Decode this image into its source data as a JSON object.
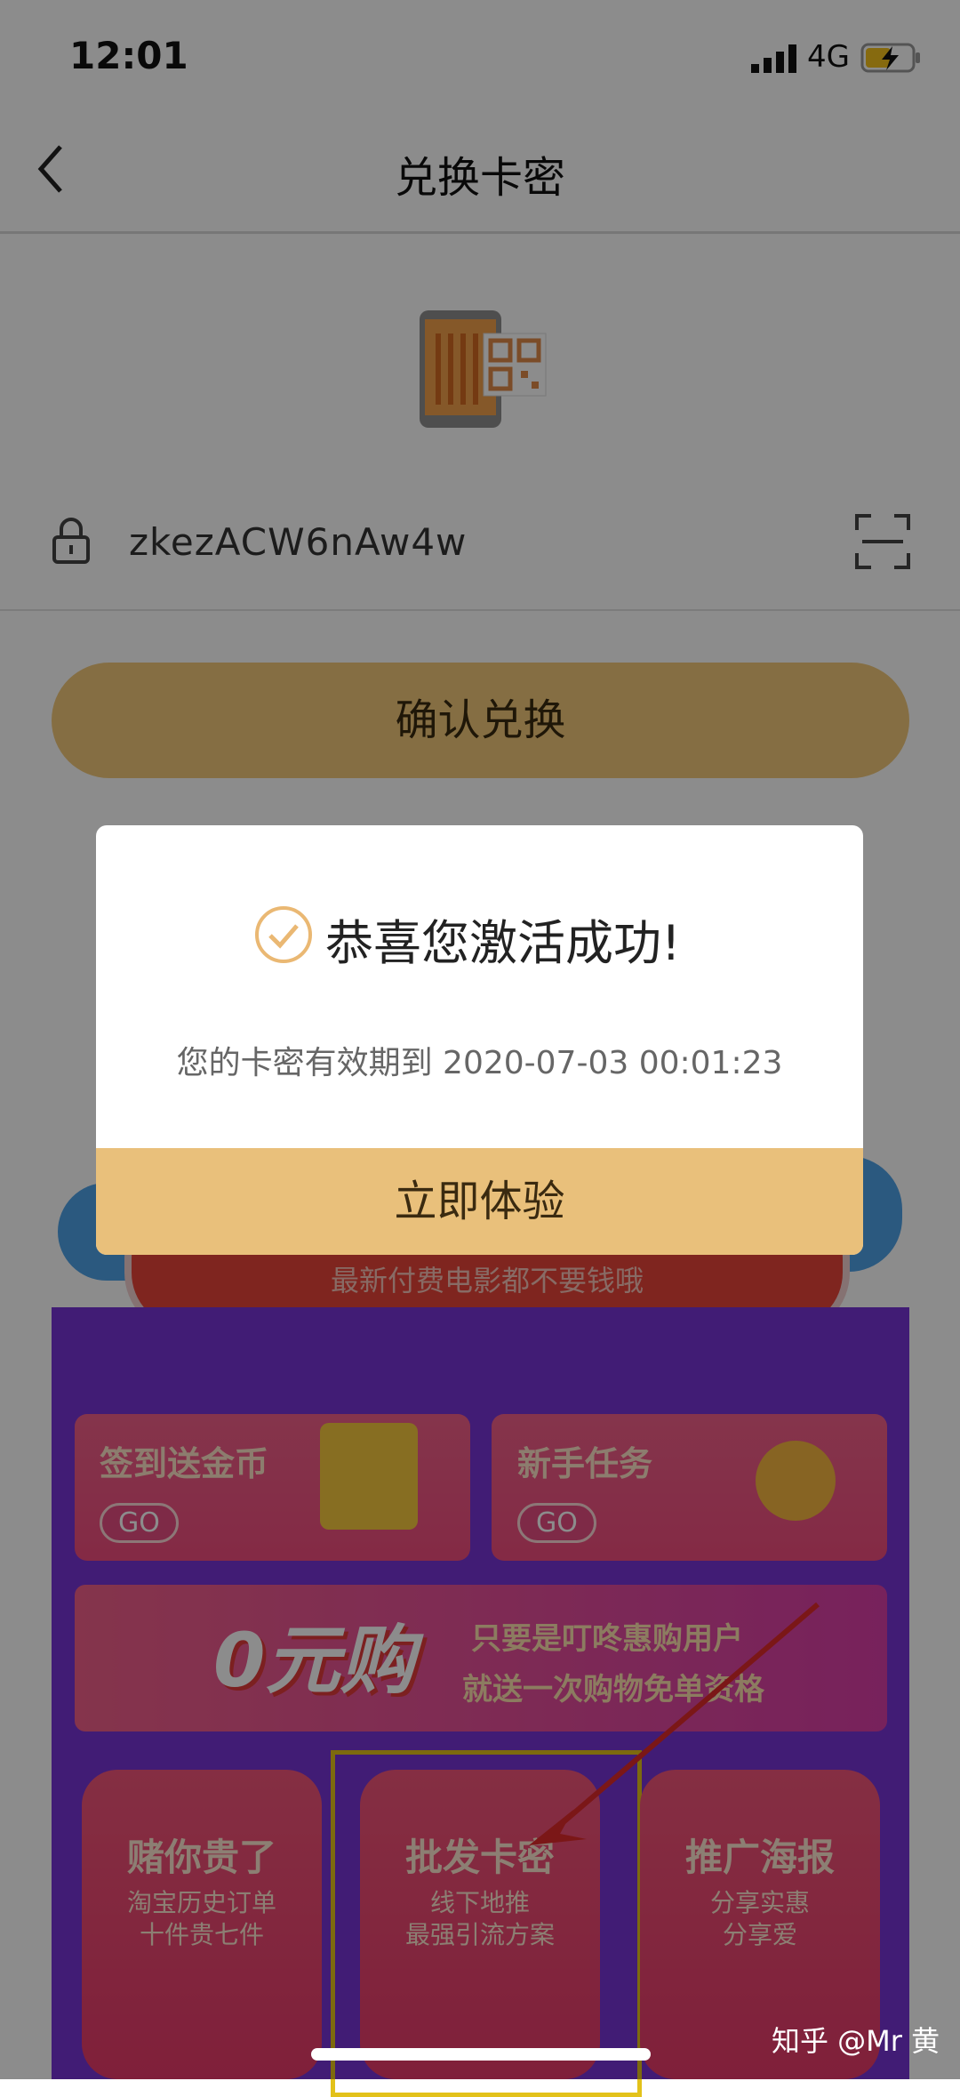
{
  "status_bar": {
    "time": "12:01",
    "network": "4G"
  },
  "nav": {
    "title": "兑换卡密"
  },
  "redeem": {
    "code": "zkezACW6nAw4w",
    "confirm_label": "确认兑换"
  },
  "promo": {
    "ribbon_text": "最新付费电影都不要钱哦",
    "cards": [
      {
        "label": "签到送金币",
        "go": "GO"
      },
      {
        "label": "新手任务",
        "go": "GO"
      }
    ],
    "zero_buy": {
      "logo": "0元购",
      "line1": "只要是叮咚惠购用户",
      "line2": "就送一次购物免单资格"
    },
    "tiles": [
      {
        "title": "赌你贵了",
        "sub1": "淘宝历史订单",
        "sub2": "十件贵七件"
      },
      {
        "title": "批发卡密",
        "sub1": "线下地推",
        "sub2": "最强引流方案"
      },
      {
        "title": "推广海报",
        "sub1": "分享实惠",
        "sub2": "分享爱"
      }
    ]
  },
  "dialog": {
    "title": "恭喜您激活成功!",
    "message": "您的卡密有效期到 2020-07-03 00:01:23",
    "button_label": "立即体验"
  },
  "watermark": "知乎 @Mr 黄",
  "colors": {
    "accent": "#f3c97a",
    "dialog_button": "#e9c07b",
    "promo_panel": "#7733d6"
  }
}
